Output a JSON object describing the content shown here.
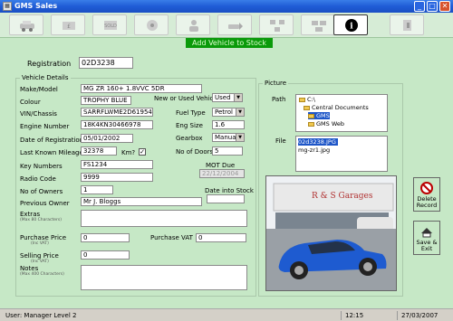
{
  "window": {
    "title": "GMS  Sales",
    "minimize_label": "_",
    "maximize_label": "□",
    "close_label": "✕"
  },
  "toolbar": {
    "buttons": [
      "car-icon",
      "money-icon",
      "sale-icon",
      "service-icon",
      "customer-icon",
      "transfer-icon",
      "network-icon",
      "info-icon",
      "exit-icon"
    ]
  },
  "banner": {
    "text": "Add Vehicle to Stock"
  },
  "registration": {
    "label": "Registration",
    "value": "02D3238"
  },
  "vehicle": {
    "group_title": "Vehicle Details",
    "make_model": {
      "label": "Make/Model",
      "value": "MG ZR 160+ 1.8VVC 5DR"
    },
    "colour": {
      "label": "Colour",
      "value": "TROPHY BLUE"
    },
    "new_or_used": {
      "label": "New or Used Vehicle",
      "value": "Used"
    },
    "vin": {
      "label": "VIN/Chassis",
      "value": "SARRFLWME2D619546"
    },
    "fuel_type": {
      "label": "Fuel Type",
      "value": "Petrol"
    },
    "engine_number": {
      "label": "Engine Number",
      "value": "18K4KN30466978"
    },
    "eng_size": {
      "label": "Eng Size",
      "value": "1.6"
    },
    "date_registration": {
      "label": "Date of Registration",
      "value": "05/01/2002"
    },
    "gearbox": {
      "label": "Gearbox",
      "value": "Manual"
    },
    "last_mileage": {
      "label": "Last Known Mileage",
      "value": "32378",
      "km_label": "Km?",
      "km_checked": "✓"
    },
    "doors": {
      "label": "No of Doors",
      "value": "5"
    },
    "key_numbers": {
      "label": "Key Numbers",
      "value": "FS1234"
    },
    "mot_due": {
      "label": "MOT Due",
      "value": "22/12/2004"
    },
    "radio_code": {
      "label": "Radio Code",
      "value": "9999"
    },
    "owners": {
      "label": "No of Owners",
      "value": "1"
    },
    "date_into_stock": {
      "label": "Date into Stock",
      "value": ""
    },
    "previous_owner": {
      "label": "Previous Owner",
      "value": "Mr J. Bloggs"
    },
    "extras": {
      "label": "Extras",
      "hint": "(Max 80 Characters)",
      "value": ""
    },
    "purchase_price": {
      "label": "Purchase Price",
      "hint": "(Inc VAT)",
      "value": "0"
    },
    "purchase_vat": {
      "label": "Purchase VAT",
      "value": "0"
    },
    "selling_price": {
      "label": "Selling Price",
      "hint": "(Inc VAT)",
      "value": "0"
    },
    "notes": {
      "label": "Notes",
      "hint": "(Max 400 Characters)",
      "value": ""
    }
  },
  "picture": {
    "group_title": "Picture",
    "path_label": "Path",
    "folders": [
      "C:\\",
      "Central Documents",
      "GMS",
      "GMS Web"
    ],
    "selected_folder": "GMS",
    "file_label": "File",
    "files": [
      "02d3238.JPG",
      "mg-zr1.jpg"
    ],
    "selected_file": "02d3238.JPG"
  },
  "actions": {
    "delete_record": "Delete Record",
    "save_exit": "Save & Exit"
  },
  "status": {
    "user": "User: Manager  Level 2",
    "time": "12:15",
    "date": "27/03/2007"
  },
  "colors": {
    "background": "#c6e8c6",
    "title_bar": "#1f5cd6",
    "banner": "#0a9a0a",
    "selection": "#1e56c8"
  }
}
